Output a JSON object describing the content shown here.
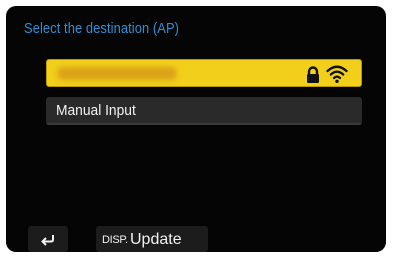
{
  "header": {
    "title": "Select the destination (AP)"
  },
  "list": {
    "items": [
      {
        "label": "",
        "selected": true,
        "locked": true,
        "signal": "wifi-full"
      },
      {
        "label": "Manual Input",
        "selected": false
      }
    ]
  },
  "footer": {
    "back_icon": "return-arrow-icon",
    "disp_key": "DISP.",
    "disp_label": "Update"
  },
  "colors": {
    "title": "#2f8fd6",
    "selected_bg": "#f1cf1b",
    "item_bg": "#2a2a2a",
    "screen_bg": "#050505"
  }
}
